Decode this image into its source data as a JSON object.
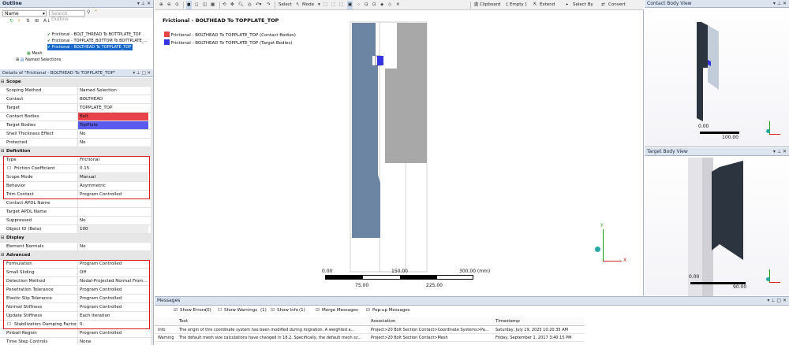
{
  "outline": {
    "title": "Outline",
    "name_dropdown": "Name",
    "search_placeholder": "Search Outline",
    "tree": [
      {
        "label": "Frictional - BOLT_THREAD To BOTTPLATE_TOP"
      },
      {
        "label": "Frictional - TOPPLATE_BOTTOM To BOTTPLATE_..."
      },
      {
        "label": "Frictional - BOLTHEAD To TOPPLATE_TOP"
      },
      {
        "label": "Mesh"
      },
      {
        "label": "Named Selections"
      }
    ]
  },
  "details": {
    "title": "Details of \"Frictional - BOLTHEAD To TOPPLATE_TOP\"",
    "rows": [
      {
        "group": true,
        "k": "Scope"
      },
      {
        "k": "Scoping Method",
        "v": "Named Selection"
      },
      {
        "k": "Contact",
        "v": "BOLTHEAD"
      },
      {
        "k": "Target",
        "v": "TOPPLATE_TOP"
      },
      {
        "k": "Contact Bodies",
        "v": "Bolt",
        "color": "#e8424a"
      },
      {
        "k": "Target Bodies",
        "v": "TopPlate",
        "color": "#5a5cf0"
      },
      {
        "k": "Shell Thickness Effect",
        "v": "No"
      },
      {
        "k": "Protected",
        "v": "No"
      },
      {
        "group": true,
        "k": "Definition"
      },
      {
        "k": "Type",
        "v": "Frictional"
      },
      {
        "k": "Friction Coefficient",
        "v": "0.15",
        "check": true
      },
      {
        "k": "Scope Mode",
        "v": "Manual",
        "shade": true
      },
      {
        "k": "Behavior",
        "v": "Asymmetric"
      },
      {
        "k": "Trim Contact",
        "v": "Program Controlled"
      },
      {
        "k": "Contact APDL Name",
        "v": ""
      },
      {
        "k": "Target APDL Name",
        "v": ""
      },
      {
        "k": "Suppressed",
        "v": "No"
      },
      {
        "k": "Object ID (Beta)",
        "v": "100",
        "shade": true
      },
      {
        "group": true,
        "k": "Display"
      },
      {
        "k": "Element Normals",
        "v": "No"
      },
      {
        "group": true,
        "k": "Advanced"
      },
      {
        "k": "Formulation",
        "v": "Program Controlled"
      },
      {
        "k": "Small Sliding",
        "v": "Off"
      },
      {
        "k": "Detection Method",
        "v": "Nodal-Projected Normal From..."
      },
      {
        "k": "Penetration Tolerance",
        "v": "Program Controlled"
      },
      {
        "k": "Elastic Slip Tolerance",
        "v": "Program Controlled"
      },
      {
        "k": "Normal Stiffness",
        "v": "Program Controlled"
      },
      {
        "k": "Update Stiffness",
        "v": "Each Iteration"
      },
      {
        "k": "Stabilization Damping Factor",
        "v": "0.",
        "check": true
      },
      {
        "k": "Pinball Region",
        "v": "Program Controlled"
      },
      {
        "k": "Time Step Controls",
        "v": "None"
      }
    ]
  },
  "toolbar": {
    "select": "Select",
    "mode": "Mode",
    "clipboard": "Clipboard",
    "empty": "[ Empty ]",
    "extend": "Extend",
    "select_by": "Select By",
    "convert": "Convert"
  },
  "viewport": {
    "title": "Frictional - BOLTHEAD To TOPPLATE_TOP",
    "legend": [
      {
        "label": "Frictional - BOLTHEAD To TOPPLATE_TOP (Contact Bodies)",
        "color": "#e8424a"
      },
      {
        "label": "Frictional - BOLTHEAD To TOPPLATE_TOP (Target Bodies)",
        "color": "#3434e0"
      }
    ],
    "scale_top": [
      "0.00",
      "150.00",
      "300.00 (mm)"
    ],
    "scale_bottom": [
      "75.00",
      "225.00"
    ],
    "colors": {
      "bolt": "#6b85a3",
      "top_plate": "#a8a8a8",
      "background": "#ffffff"
    }
  },
  "contact_view": {
    "title": "Contact Body View",
    "scale": [
      "0.00",
      "100.00"
    ]
  },
  "target_view": {
    "title": "Target Body View",
    "scale": [
      "0.00",
      "90.00"
    ]
  },
  "messages": {
    "title": "Messages",
    "filters": [
      {
        "label": "Show Errors",
        "count": "(0)"
      },
      {
        "label": "Show Warnings",
        "count": "(1)"
      },
      {
        "label": "Show Info",
        "count": "(1)"
      },
      {
        "label": "Merge Messages",
        "count": ""
      },
      {
        "label": "Pop-up Messages",
        "count": ""
      }
    ],
    "columns": [
      "Text",
      "Association",
      "Timestamp"
    ],
    "rows": [
      {
        "type": "Info",
        "text": "The origin of this coordinate system has been modified during migration. A weighted a...",
        "assoc": "Project>20 Bolt Section Contact>Coordinate Systems>Pa...",
        "time": "Saturday, July 19, 2025 10:20:35 AM"
      },
      {
        "type": "Warning",
        "text": "The default mesh size calculations have changed in 18.2. Specifically, the default mesh sz...",
        "assoc": "Project>20 Bolt Section Contact>Mesh",
        "time": "Friday, September 1, 2017 3:40:15 PM"
      }
    ]
  }
}
